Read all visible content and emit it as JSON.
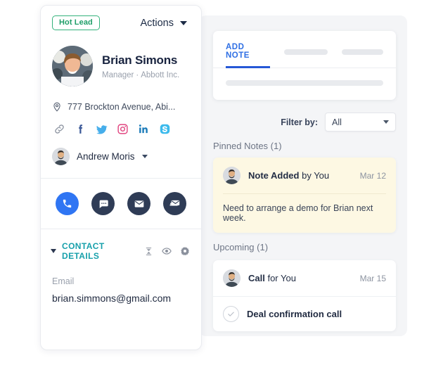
{
  "contact_card": {
    "badge": "Hot Lead",
    "actions_label": "Actions",
    "name": "Brian Simons",
    "role": "Manager",
    "company": "Abbott Inc.",
    "separator": "·",
    "address": "777 Brockton Avenue, Abi...",
    "socials": [
      {
        "name": "link-icon",
        "color": "#8c93a0"
      },
      {
        "name": "facebook-icon",
        "color": "#3b5998"
      },
      {
        "name": "twitter-icon",
        "color": "#46aeeb"
      },
      {
        "name": "instagram-icon",
        "color": "#e1447f"
      },
      {
        "name": "linkedin-icon",
        "color": "#1b7bb9"
      },
      {
        "name": "skype-icon",
        "color": "#3cbaec"
      }
    ],
    "owner_name": "Andrew Moris",
    "quick_actions": [
      {
        "name": "call-button",
        "icon": "phone-icon",
        "color": "#2f75f3"
      },
      {
        "name": "sms-button",
        "icon": "chat-bubble-icon",
        "color": "#2f3c56"
      },
      {
        "name": "email-button",
        "icon": "envelope-icon",
        "color": "#2f3c56"
      },
      {
        "name": "bulk-email-button",
        "icon": "envelopes-icon",
        "color": "#2f3c56"
      }
    ],
    "details_section": {
      "title": "CONTACT DETAILS",
      "title_color": "#17a0ab",
      "tools": [
        "collapse-icon",
        "eye-icon",
        "gear-icon"
      ]
    },
    "email_label": "Email",
    "email_value": "brian.simmons@gmail.com"
  },
  "activity_panel": {
    "tabs": [
      {
        "label": "ADD NOTE",
        "active": true
      },
      {
        "label": "",
        "active": false
      },
      {
        "label": "",
        "active": false
      }
    ],
    "active_tab_color": "#2558d6",
    "note_input_placeholder": "",
    "filter": {
      "label": "Filter by:",
      "value": "All"
    },
    "pinned": {
      "heading": "Pinned Notes (1)",
      "card_color": "#fdf8e3",
      "title_bold": "Note Added",
      "title_rest": "by You",
      "date": "Mar 12",
      "body": "Need to arrange a demo for Brian next week."
    },
    "upcoming": {
      "heading": "Upcoming (1)",
      "title_bold": "Call",
      "title_rest": "for You",
      "date": "Mar 15",
      "task": "Deal confirmation call"
    }
  }
}
